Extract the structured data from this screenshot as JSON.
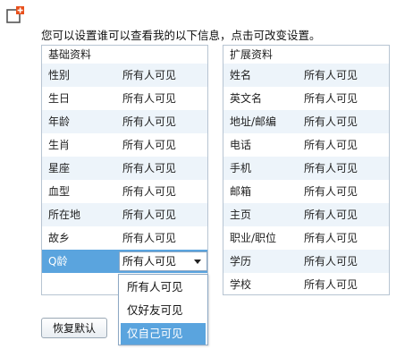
{
  "prompt": "您可以设置谁可以查看我的以下信息，点击可改变设置。",
  "basic": {
    "header": "基础资料",
    "rows": [
      {
        "name": "性别",
        "value": "所有人可见"
      },
      {
        "name": "生日",
        "value": "所有人可见"
      },
      {
        "name": "年龄",
        "value": "所有人可见"
      },
      {
        "name": "生肖",
        "value": "所有人可见"
      },
      {
        "name": "星座",
        "value": "所有人可见"
      },
      {
        "name": "血型",
        "value": "所有人可见"
      },
      {
        "name": "所在地",
        "value": "所有人可见"
      },
      {
        "name": "故乡",
        "value": "所有人可见"
      },
      {
        "name": "Q龄",
        "value": "所有人可见"
      }
    ]
  },
  "extended": {
    "header": "扩展资料",
    "rows": [
      {
        "name": "姓名",
        "value": "所有人可见"
      },
      {
        "name": "英文名",
        "value": "所有人可见"
      },
      {
        "name": "地址/邮编",
        "value": "所有人可见"
      },
      {
        "name": "电话",
        "value": "所有人可见"
      },
      {
        "name": "手机",
        "value": "所有人可见"
      },
      {
        "name": "邮箱",
        "value": "所有人可见"
      },
      {
        "name": "主页",
        "value": "所有人可见"
      },
      {
        "name": "职业/职位",
        "value": "所有人可见"
      },
      {
        "name": "学历",
        "value": "所有人可见"
      },
      {
        "name": "学校",
        "value": "所有人可见"
      }
    ]
  },
  "dropdown": {
    "options": [
      "所有人可见",
      "仅好友可见",
      "仅自己可见"
    ],
    "highlighted": 2
  },
  "reset_button": "恢复默认",
  "colors": {
    "accent": "#5aa4de",
    "row_alt": "#edf4fa",
    "border": "#b7c4d2",
    "icon": "#e8501c"
  },
  "icons": {
    "app": "edit-plus-icon",
    "dropdown_arrow": "chevron-down-icon"
  }
}
